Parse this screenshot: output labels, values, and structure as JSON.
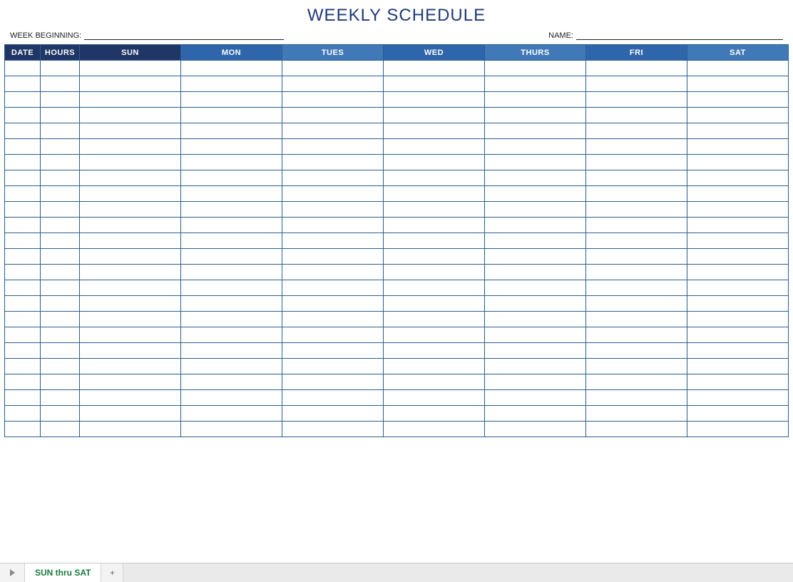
{
  "title": "WEEKLY SCHEDULE",
  "meta": {
    "week_label": "WEEK BEGINNING:",
    "week_value": "",
    "name_label": "NAME:",
    "name_value": ""
  },
  "headers": [
    "DATE",
    "HOURS",
    "SUN",
    "MON",
    "TUES",
    "WED",
    "THURS",
    "FRI",
    "SAT"
  ],
  "header_styles": [
    "dark",
    "dark",
    "dark",
    "mid",
    "light",
    "mid",
    "light",
    "mid",
    "light"
  ],
  "row_count": 24,
  "tabbar": {
    "active_tab": "SUN thru SAT",
    "add_label": "+"
  }
}
